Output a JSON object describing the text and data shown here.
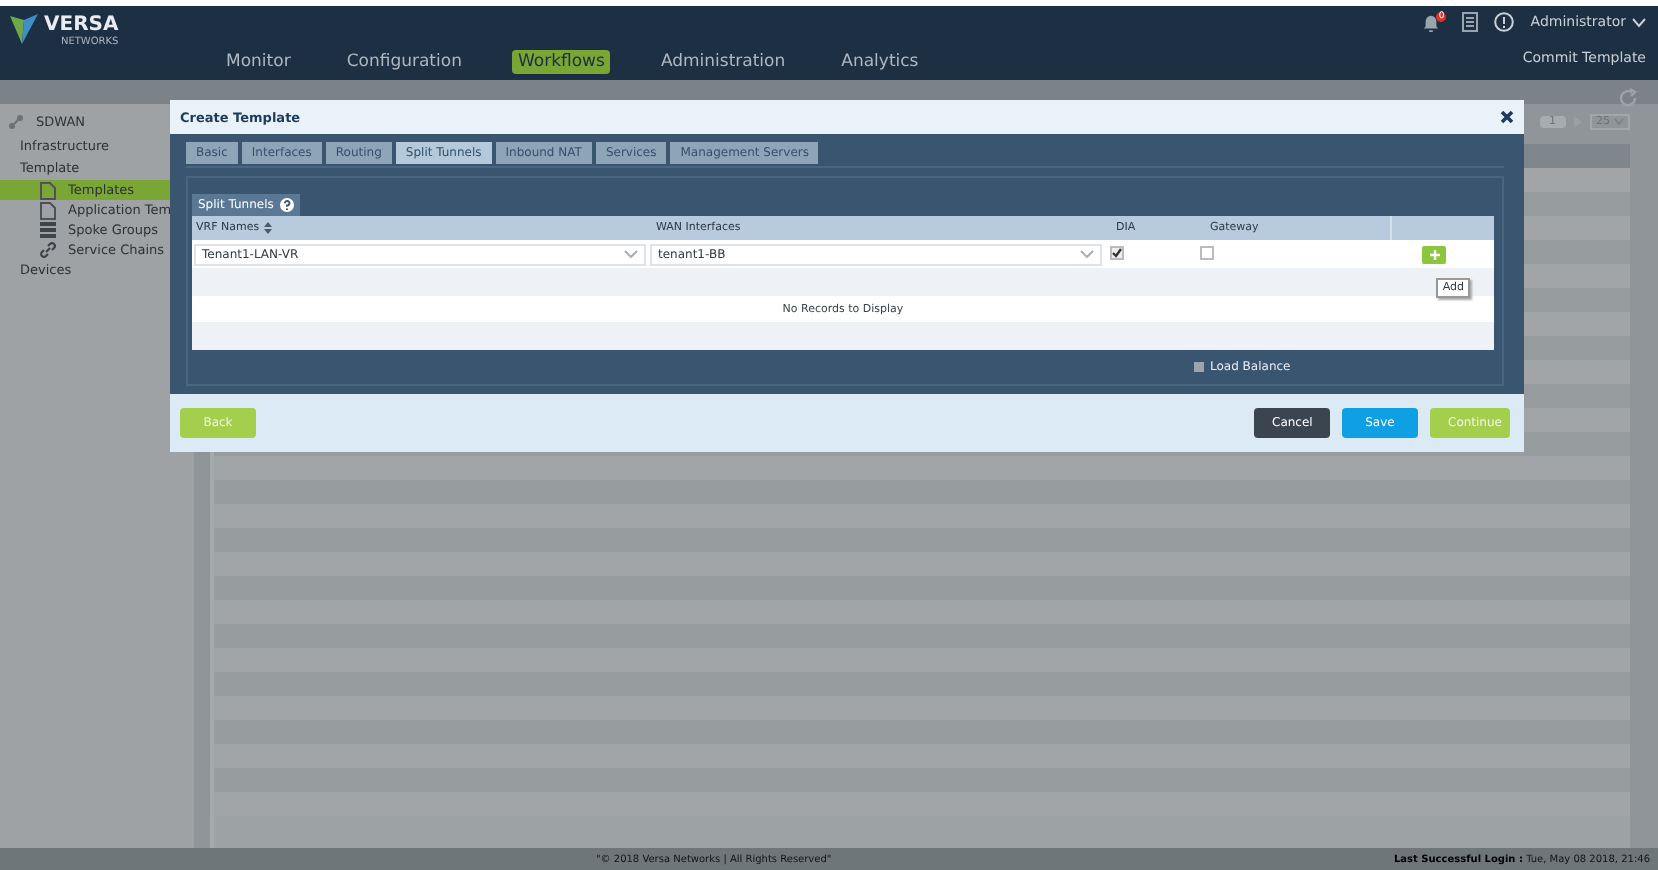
{
  "header": {
    "logo": "VERSA",
    "logo_sub": "NETWORKS",
    "nav": [
      {
        "label": "Monitor",
        "selected": false
      },
      {
        "label": "Configuration",
        "selected": false
      },
      {
        "label": "Workflows",
        "selected": true
      },
      {
        "label": "Administration",
        "selected": false
      },
      {
        "label": "Analytics",
        "selected": false
      }
    ],
    "notification_count": "0",
    "user": "Administrator",
    "commit": "Commit Template"
  },
  "sidebar": {
    "root": "SDWAN",
    "items": [
      {
        "label": "Infrastructure",
        "selected": false
      },
      {
        "label": "Template",
        "selected": false,
        "children": [
          {
            "label": "Templates",
            "selected": true
          },
          {
            "label": "Application Tem",
            "selected": false
          },
          {
            "label": "Spoke Groups",
            "selected": false
          },
          {
            "label": "Service Chains",
            "selected": false
          }
        ]
      },
      {
        "label": "Devices",
        "selected": false
      }
    ]
  },
  "pager": {
    "page": "1",
    "page_size": "25"
  },
  "dialog": {
    "title": "Create Template",
    "tabs": [
      {
        "label": "Basic",
        "selected": false
      },
      {
        "label": "Interfaces",
        "selected": false
      },
      {
        "label": "Routing",
        "selected": false
      },
      {
        "label": "Split Tunnels",
        "selected": true
      },
      {
        "label": "Inbound NAT",
        "selected": false
      },
      {
        "label": "Services",
        "selected": false
      },
      {
        "label": "Management Servers",
        "selected": false
      }
    ],
    "section": "Split Tunnels",
    "columns": [
      "VRF Names",
      "WAN Interfaces",
      "DIA",
      "Gateway"
    ],
    "rows": [
      {
        "vrf": "Tenant1-LAN-VR",
        "wan": "tenant1-BB",
        "dia": true,
        "gateway": false
      }
    ],
    "empty_message": "No Records to Display",
    "add_tooltip": "Add",
    "load_balance": {
      "label": "Load Balance",
      "checked": false
    },
    "buttons": [
      {
        "label": "Back",
        "kind": "back"
      },
      {
        "label": "Cancel",
        "kind": "cancel"
      },
      {
        "label": "Save",
        "kind": "save"
      },
      {
        "label": "Continue",
        "kind": "continue"
      }
    ]
  },
  "footer": {
    "copyright": "\"© 2018 Versa Networks | All Rights Reserved\"",
    "login": "**Last Successful Login :** Tue, May 08 2018, 21:46"
  }
}
